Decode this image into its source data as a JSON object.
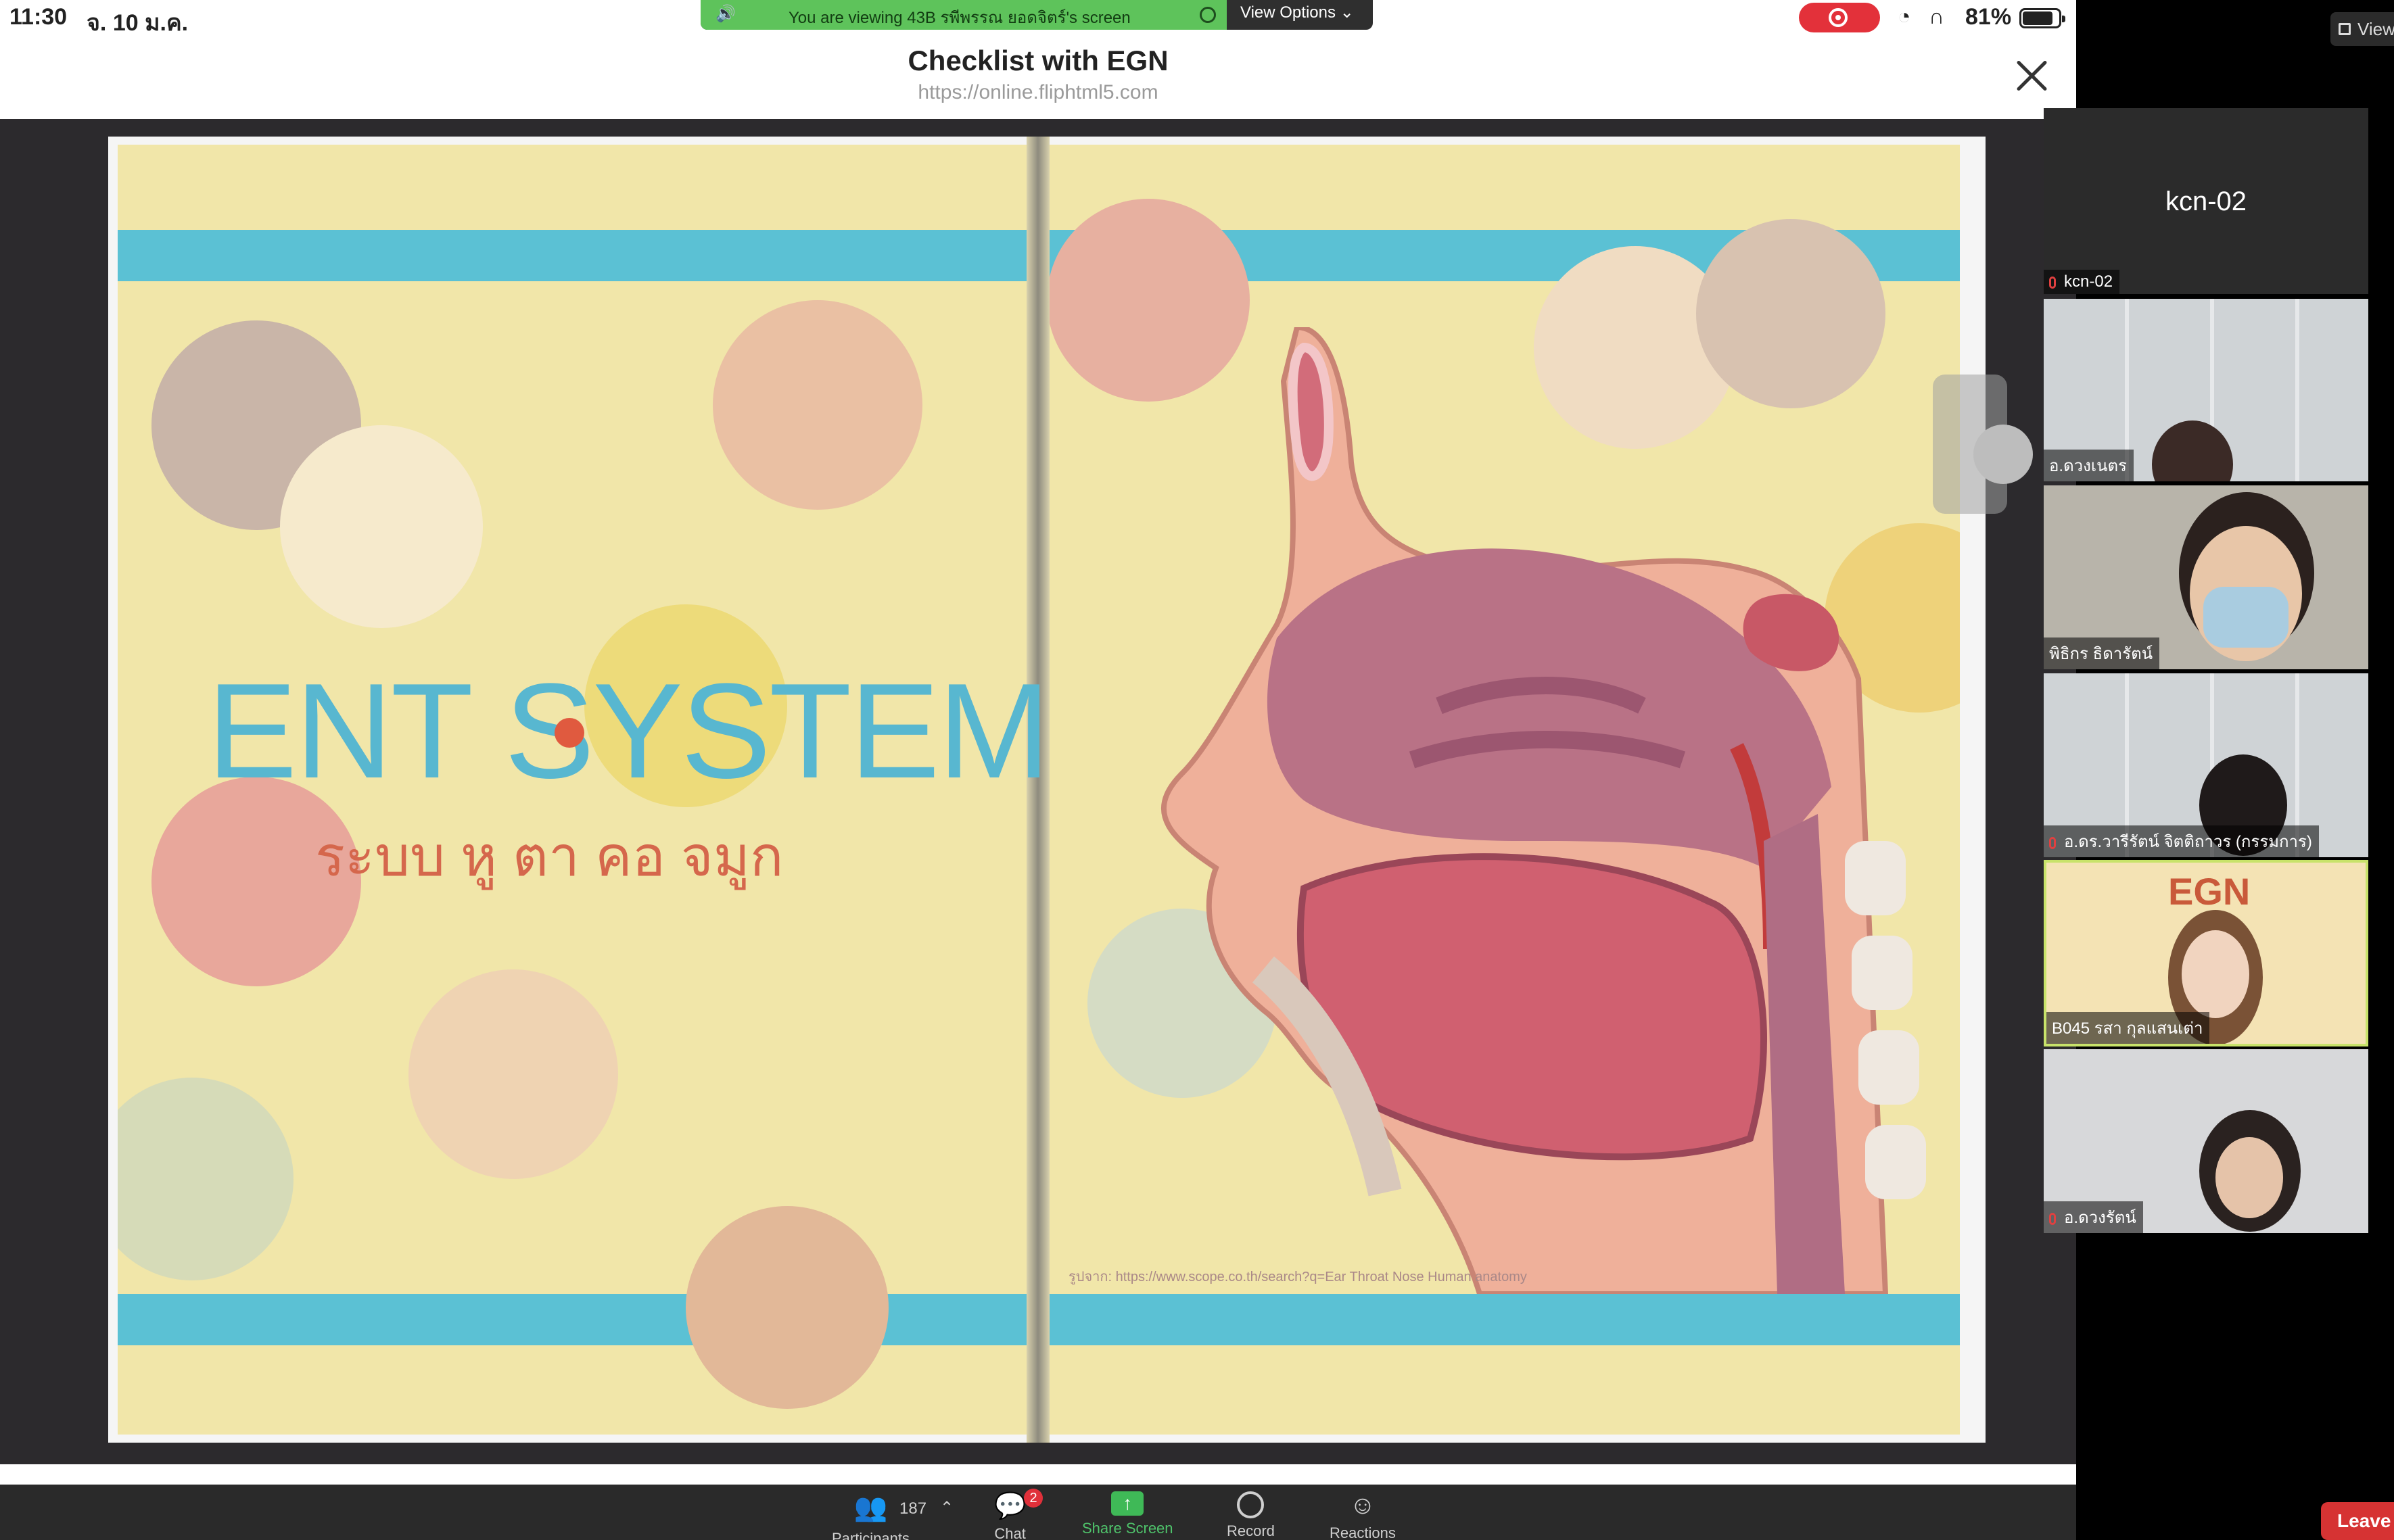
{
  "status_bar": {
    "time": "11:30",
    "date": "จ. 10 ม.ค.",
    "battery": "81%"
  },
  "share_banner": {
    "message": "You are viewing 43B รพีพรรณ ยอดจิตร์'s screen",
    "view_options": "View Options ⌄"
  },
  "shared_page": {
    "title": "Checklist with EGN",
    "url": "https://online.fliphtml5.com",
    "slide_title": "ENT SYSTEM",
    "slide_subtitle": "ระบบ หู ตา คอ จมูก",
    "image_credit": "รูปจาก: https://www.scope.co.th/search?q=Ear Throat Nose Human anatomy"
  },
  "panel": {
    "view_button": "View"
  },
  "participants": [
    {
      "name": "kcn-02",
      "label": "kcn-02",
      "muted": true
    },
    {
      "name": "อ.ดวงเนตร",
      "muted": false
    },
    {
      "name": "พิธิกร ธิดารัตน์",
      "muted": false
    },
    {
      "name": "อ.ดร.วารีรัตน์ จิตติถาวร (กรรมการ)",
      "muted": true
    },
    {
      "name": "B045 รสา กุลแสนเต่า",
      "muted": false,
      "active_speaker": true,
      "tile_sign": "EGN"
    },
    {
      "name": "อ.ดวงรัตน์",
      "muted": true
    }
  ],
  "toolbar": {
    "participants_count": "187",
    "participants_label": "Participants",
    "chat_label": "Chat",
    "chat_badge": "2",
    "share_label": "Share Screen",
    "record_label": "Record",
    "reactions_label": "Reactions",
    "leave_label": "Leave"
  }
}
